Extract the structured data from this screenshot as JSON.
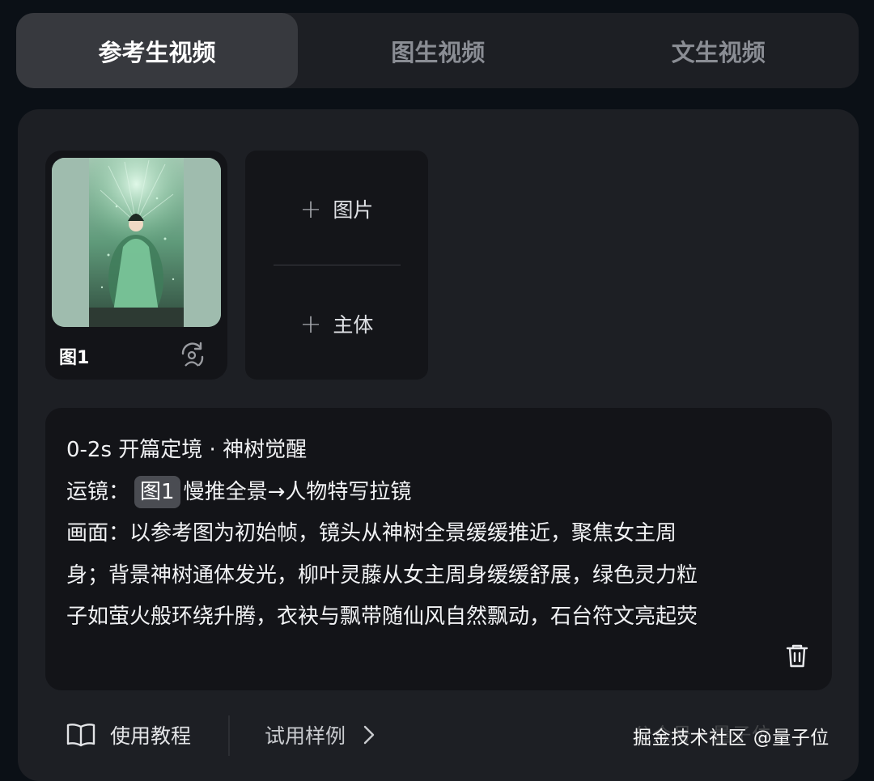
{
  "tabs": [
    {
      "label": "参考生视频",
      "active": true
    },
    {
      "label": "图生视频",
      "active": false
    },
    {
      "label": "文生视频",
      "active": false
    }
  ],
  "reference": {
    "image_label": "图1",
    "swap_icon": "swap-icon",
    "add_image_label": "图片",
    "add_subject_label": "主体"
  },
  "prompt": {
    "line1": "0-2s 开篇定境 · 神树觉醒",
    "line2_prefix": "运镜：",
    "line2_chip": "图1",
    "line2_suffix": "慢推全景→人物特写拉镜",
    "line3": "画面：以参考图为初始帧，镜头从神树全景缓缓推近，聚焦女主周",
    "line4": "身；背景神树通体发光，柳叶灵藤从女主周身缓缓舒展，绿色灵力粒",
    "line5": "子如萤火般环绕升腾，衣袂与飘带随仙风自然飘动，石台符文亮起荧"
  },
  "footer": {
    "tutorial_label": "使用教程",
    "examples_label": "试用样例",
    "watermark": "掘金技术社区 @量子位",
    "watermark_ghost": "公众号 · 量子位"
  },
  "colors": {
    "background": "#0b1016",
    "panel": "#1d1f24",
    "active_tab": "#37393e",
    "chip": "#4a4c52"
  }
}
